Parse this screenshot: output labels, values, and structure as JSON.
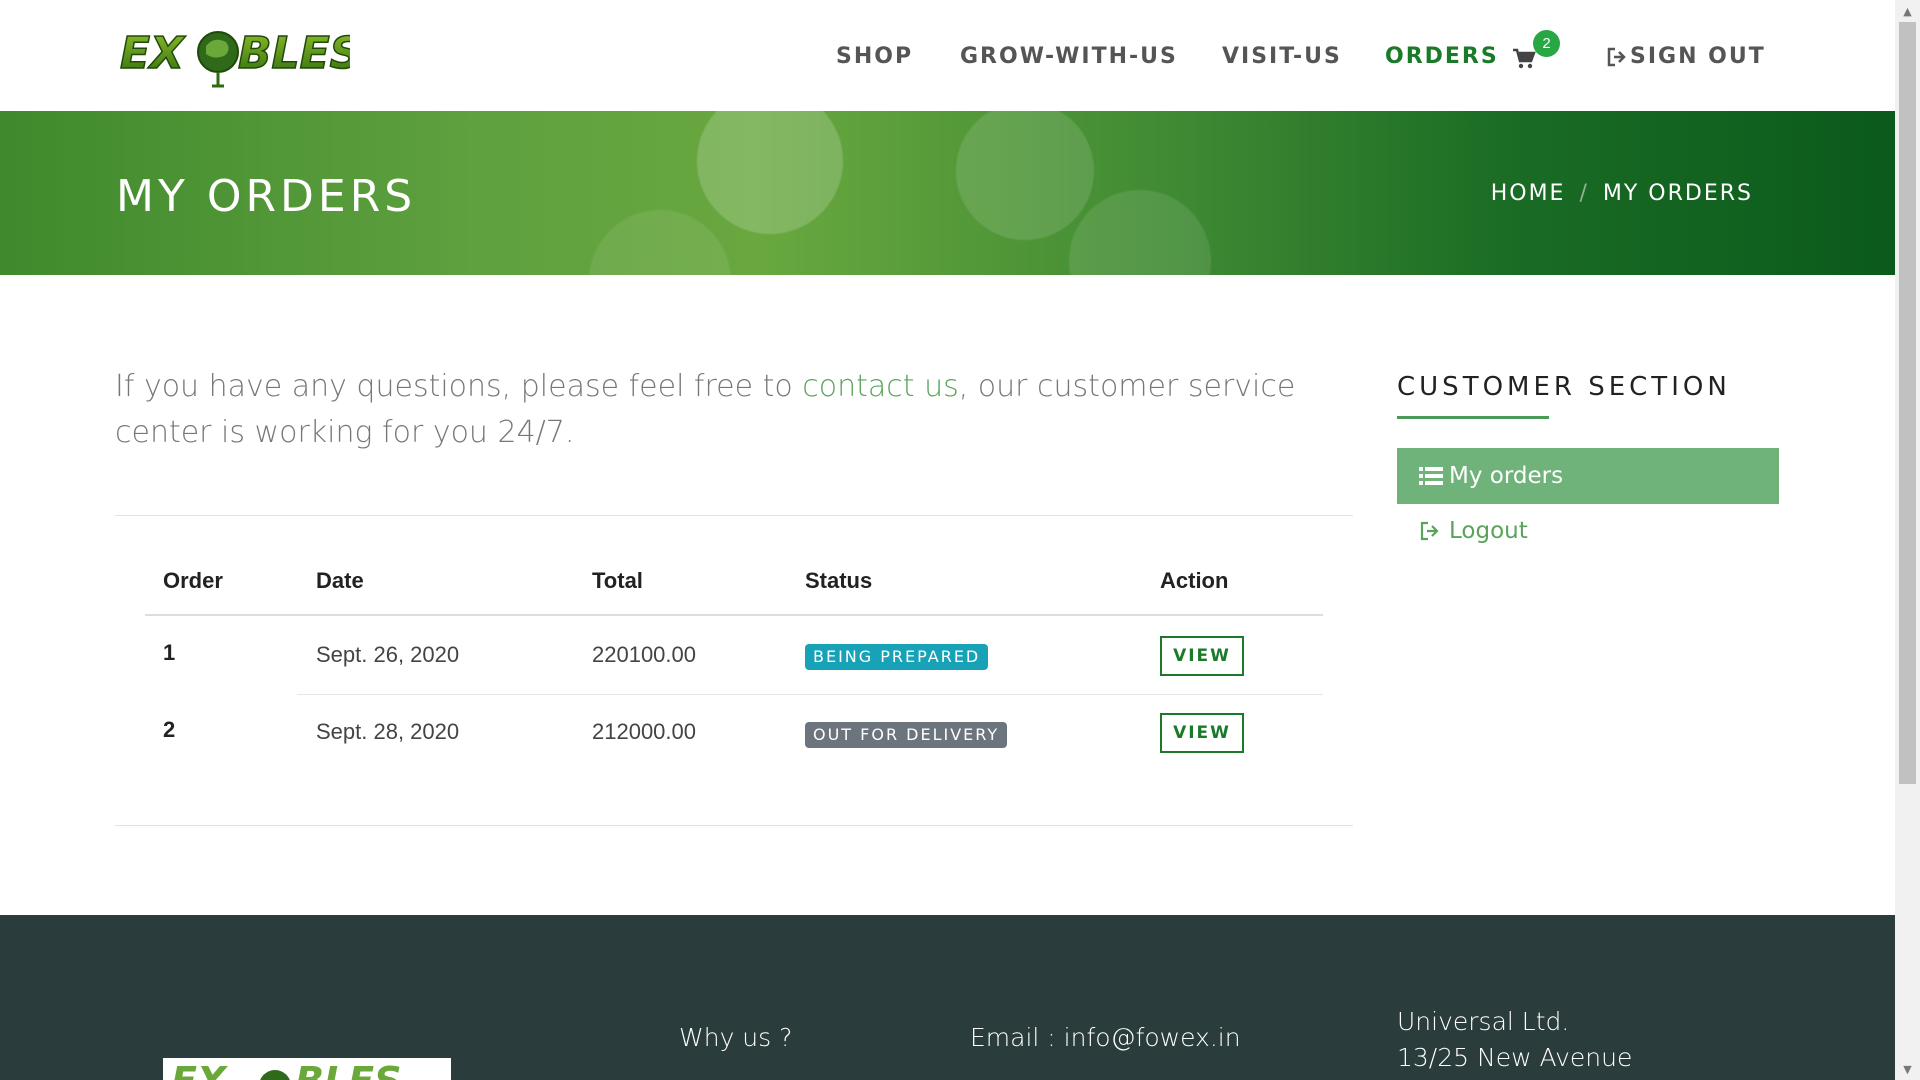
{
  "brand": {
    "logo_text": "EXOBLES"
  },
  "nav": {
    "items": [
      {
        "label": "SHOP"
      },
      {
        "label": "GROW-WITH-US"
      },
      {
        "label": "VISIT-US"
      },
      {
        "label": "ORDERS"
      }
    ],
    "active": "ORDERS",
    "cart_count": "2",
    "signout_label": "SIGN OUT"
  },
  "banner": {
    "title": "MY ORDERS",
    "breadcrumb": [
      "HOME",
      "MY ORDERS"
    ]
  },
  "intro": {
    "before": "If you have any questions, please feel free to ",
    "link": "contact us",
    "after": ", our customer service center is working for you 24/7."
  },
  "orders": {
    "headers": [
      "Order",
      "Date",
      "Total",
      "Status",
      "Action"
    ],
    "rows": [
      {
        "order": "1",
        "date": "Sept. 26, 2020",
        "total": "220100.00",
        "status": "BEING PREPARED",
        "action": "VIEW"
      },
      {
        "order": "2",
        "date": "Sept. 28, 2020",
        "total": "212000.00",
        "status": "OUT FOR DELIVERY",
        "action": "VIEW"
      }
    ]
  },
  "sidebar": {
    "title": "CUSTOMER SECTION",
    "items": [
      {
        "label": "My orders",
        "icon": "list-icon"
      },
      {
        "label": "Logout",
        "icon": "sign-out-icon"
      }
    ]
  },
  "footer": {
    "why_us": "Why us ?",
    "email": "Email : info@fowex.in",
    "company": "Universal Ltd.",
    "address": "13/25 New Avenue"
  },
  "colors": {
    "brand_green": "#1b7a2a",
    "accent_green": "#6fb27a",
    "info_badge": "#17a2b8",
    "secondary_badge": "#6c757d",
    "footer_bg": "#2b3c3c"
  }
}
